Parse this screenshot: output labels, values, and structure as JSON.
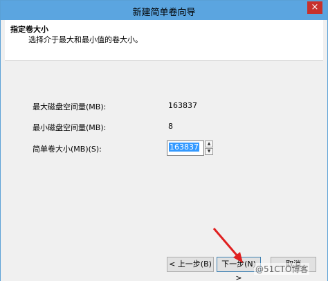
{
  "window": {
    "title": "新建简单卷向导",
    "close_glyph": "×"
  },
  "header": {
    "title": "指定卷大小",
    "subtitle": "选择介于最大和最小值的卷大小。"
  },
  "form": {
    "max_label": "最大磁盘空间量(MB):",
    "max_value": "163837",
    "min_label": "最小磁盘空间量(MB):",
    "min_value": "8",
    "size_label": "简单卷大小(MB)(S):",
    "size_value": "163837"
  },
  "buttons": {
    "back": "< 上一步(B)",
    "next": "下一步(N) >",
    "cancel": "取消"
  },
  "watermark": "@51CTO博客",
  "colors": {
    "titlebar": "#5ba5e0",
    "close": "#c7312c",
    "selection": "#3399ff",
    "annotation_arrow": "#e02020"
  },
  "icons": {
    "close": "close-icon",
    "spin_up": "spin-up-icon",
    "spin_down": "spin-down-icon"
  }
}
